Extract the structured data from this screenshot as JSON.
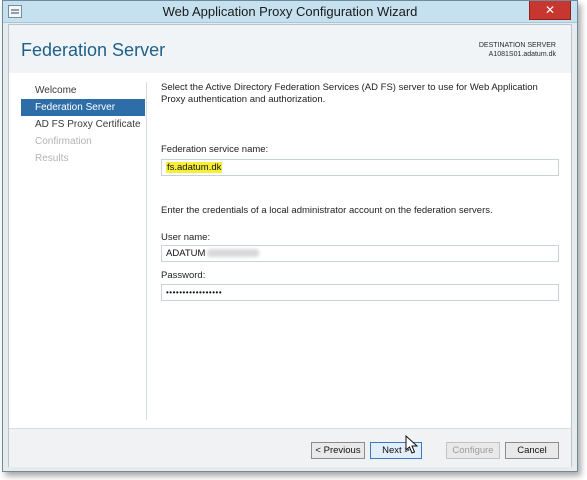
{
  "window": {
    "title": "Web Application Proxy Configuration Wizard",
    "close_label": "✕"
  },
  "header": {
    "page_title": "Federation Server",
    "destination_label": "DESTINATION SERVER",
    "destination_value": "A1081S01.adatum.dk"
  },
  "sidebar": {
    "items": [
      {
        "label": "Welcome"
      },
      {
        "label": "Federation Server"
      },
      {
        "label": "AD FS Proxy Certificate"
      },
      {
        "label": "Confirmation"
      },
      {
        "label": "Results"
      }
    ]
  },
  "main": {
    "description": "Select the Active Directory Federation Services (AD FS) server to use for Web Application Proxy authentication and authorization.",
    "federation_label": "Federation service name:",
    "federation_value": "fs.adatum.dk",
    "credentials_text": "Enter the credentials of a local administrator account on the federation servers.",
    "username_label": "User name:",
    "username_value": "ADATUM",
    "password_label": "Password:",
    "password_value": "•••••••••••••••••"
  },
  "footer": {
    "previous_label": "< Previous",
    "next_label": "Next >",
    "configure_label": "Configure",
    "cancel_label": "Cancel"
  }
}
